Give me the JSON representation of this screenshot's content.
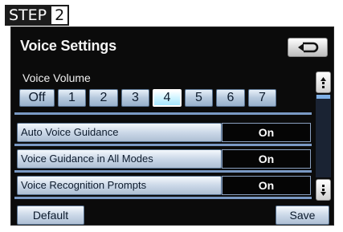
{
  "step": {
    "label": "STEP",
    "number": "2"
  },
  "header": {
    "title": "Voice Settings",
    "back_icon": "return-arrow-icon"
  },
  "voice_volume": {
    "label": "Voice Volume",
    "options": [
      "Off",
      "1",
      "2",
      "3",
      "4",
      "5",
      "6",
      "7"
    ],
    "selected": "4"
  },
  "settings": [
    {
      "label": "Auto Voice Guidance",
      "value": "On"
    },
    {
      "label": "Voice Guidance in All Modes",
      "value": "On"
    },
    {
      "label": "Voice Recognition Prompts",
      "value": "On"
    }
  ],
  "footer": {
    "default_label": "Default",
    "save_label": "Save"
  },
  "colors": {
    "screen_bg": "#0b0b0b",
    "button_blue": "#b5c8dc",
    "selected_cyan": "#d0f4ff",
    "separator": "#7a99c4"
  }
}
